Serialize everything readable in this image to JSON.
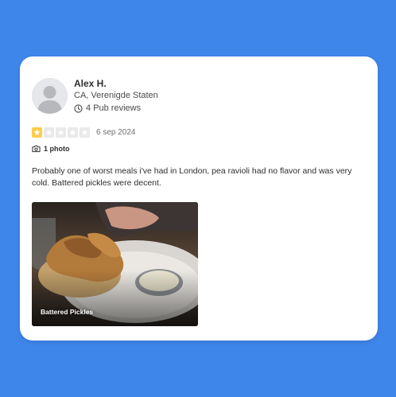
{
  "review": {
    "user": {
      "name": "Alex H.",
      "location": "CA, Verenigde Staten",
      "review_count": "4 Pub reviews"
    },
    "rating": 1,
    "max_rating": 5,
    "date": "6 sep 2024",
    "photo_count": "1 photo",
    "text": "Probably one of worst meals i've had in London, pea ravioli had no flavor and was very cold. Battered pickles were decent.",
    "photo": {
      "caption": "Battered Pickles"
    }
  },
  "colors": {
    "background": "#3f86ea",
    "star_filled": "#ffcc4b",
    "star_empty": "#e9e9ea"
  },
  "icons": {
    "reviews": "clock-icon",
    "photos": "camera-icon",
    "avatar": "user-silhouette-icon"
  }
}
